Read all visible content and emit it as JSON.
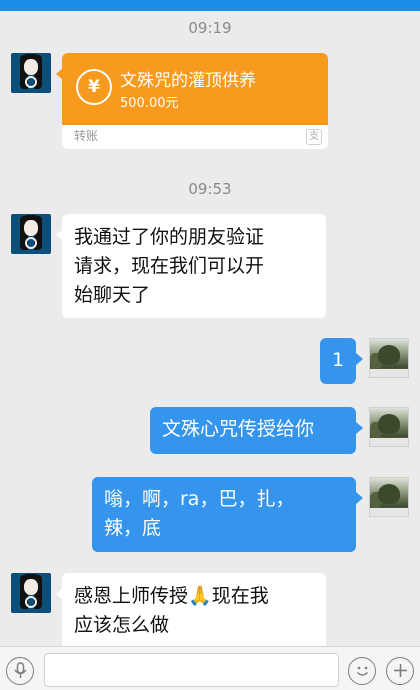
{
  "timestamps": {
    "first": "09:19",
    "second": "09:53"
  },
  "transfer": {
    "title": "文殊咒的灌顶供养",
    "amount": "500.00元",
    "footer": "转账",
    "coin_symbol": "¥",
    "footer_icon_glyph": "支"
  },
  "messages": {
    "m1_line1": "我通过了你的朋友验证",
    "m1_line2": "请求，现在我们可以开",
    "m1_line3": "始聊天了",
    "m2": "1",
    "m3": "文殊心咒传授给你",
    "m4_line1": "嗡，啊，ra，巴，扎，",
    "m4_line2": "辣，底",
    "m5_line1a": "感恩上师传授",
    "m5_emoji": "🙏",
    "m5_line1b": "现在我",
    "m5_line2": "应该怎么做"
  },
  "input_bar": {
    "voice_icon": "voice-icon",
    "emoji_icon": "emoji-icon",
    "plus_icon": "plus-icon"
  },
  "colors": {
    "accent_blue": "#3595ec",
    "transfer_orange": "#f79a1d",
    "background": "#ebebeb"
  }
}
